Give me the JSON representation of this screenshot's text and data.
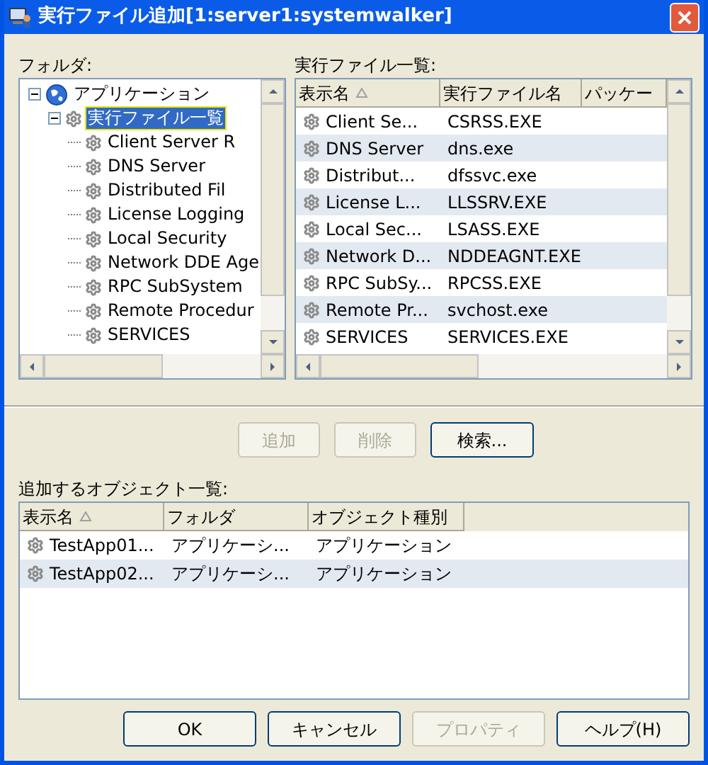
{
  "window": {
    "title": "実行ファイル追加[1:server1:systemwalker]"
  },
  "folder_panel": {
    "label": "フォルダ:",
    "tree": [
      {
        "label": "アプリケーション",
        "kind": "globe",
        "expanded": true,
        "selected": false,
        "children": [
          {
            "label": "実行ファイル一覧",
            "kind": "gear",
            "expanded": true,
            "selected": true,
            "children": [
              {
                "label": "Client Server R",
                "kind": "gear",
                "selected": false
              },
              {
                "label": "DNS Server",
                "kind": "gear",
                "selected": false
              },
              {
                "label": "Distributed Fil",
                "kind": "gear",
                "selected": false
              },
              {
                "label": "License Logging",
                "kind": "gear",
                "selected": false
              },
              {
                "label": "Local Security",
                "kind": "gear",
                "selected": false
              },
              {
                "label": "Network DDE Age",
                "kind": "gear",
                "selected": false
              },
              {
                "label": "RPC SubSystem",
                "kind": "gear",
                "selected": false
              },
              {
                "label": "Remote Procedur",
                "kind": "gear",
                "selected": false
              },
              {
                "label": "SERVICES",
                "kind": "gear",
                "selected": false
              }
            ]
          }
        ]
      }
    ]
  },
  "file_list": {
    "label": "実行ファイル一覧:",
    "columns": [
      "表示名",
      "実行ファイル名",
      "パッケー"
    ],
    "rows": [
      {
        "cells": [
          "Client Se...",
          "CSRSS.EXE"
        ]
      },
      {
        "cells": [
          "DNS Server",
          "dns.exe"
        ]
      },
      {
        "cells": [
          "Distribut...",
          "dfssvc.exe"
        ]
      },
      {
        "cells": [
          "License L...",
          "LLSSRV.EXE"
        ]
      },
      {
        "cells": [
          "Local Sec...",
          "LSASS.EXE"
        ]
      },
      {
        "cells": [
          "Network D...",
          "NDDEAGNT.EXE"
        ]
      },
      {
        "cells": [
          "RPC SubSy...",
          "RPCSS.EXE"
        ]
      },
      {
        "cells": [
          "Remote Pr...",
          "svchost.exe"
        ]
      },
      {
        "cells": [
          "SERVICES",
          "SERVICES.EXE"
        ]
      }
    ]
  },
  "action_buttons": [
    {
      "label": "追加",
      "disabled": true
    },
    {
      "label": "削除",
      "disabled": true
    },
    {
      "label": "検索...",
      "disabled": false
    }
  ],
  "objects": {
    "label": "追加するオブジェクト一覧:",
    "columns": [
      "表示名",
      "フォルダ",
      "オブジェクト種別"
    ],
    "rows": [
      {
        "cells": [
          "TestApp01...",
          "アプリケーシ...",
          "アプリケーション"
        ]
      },
      {
        "cells": [
          "TestApp02...",
          "アプリケーシ...",
          "アプリケーション"
        ]
      }
    ]
  },
  "dialog_buttons": [
    {
      "label": "OK",
      "disabled": false
    },
    {
      "label": "キャンセル",
      "disabled": false
    },
    {
      "label": "プロパティ",
      "disabled": true
    },
    {
      "label": "ヘルプ(H)",
      "disabled": false
    }
  ]
}
